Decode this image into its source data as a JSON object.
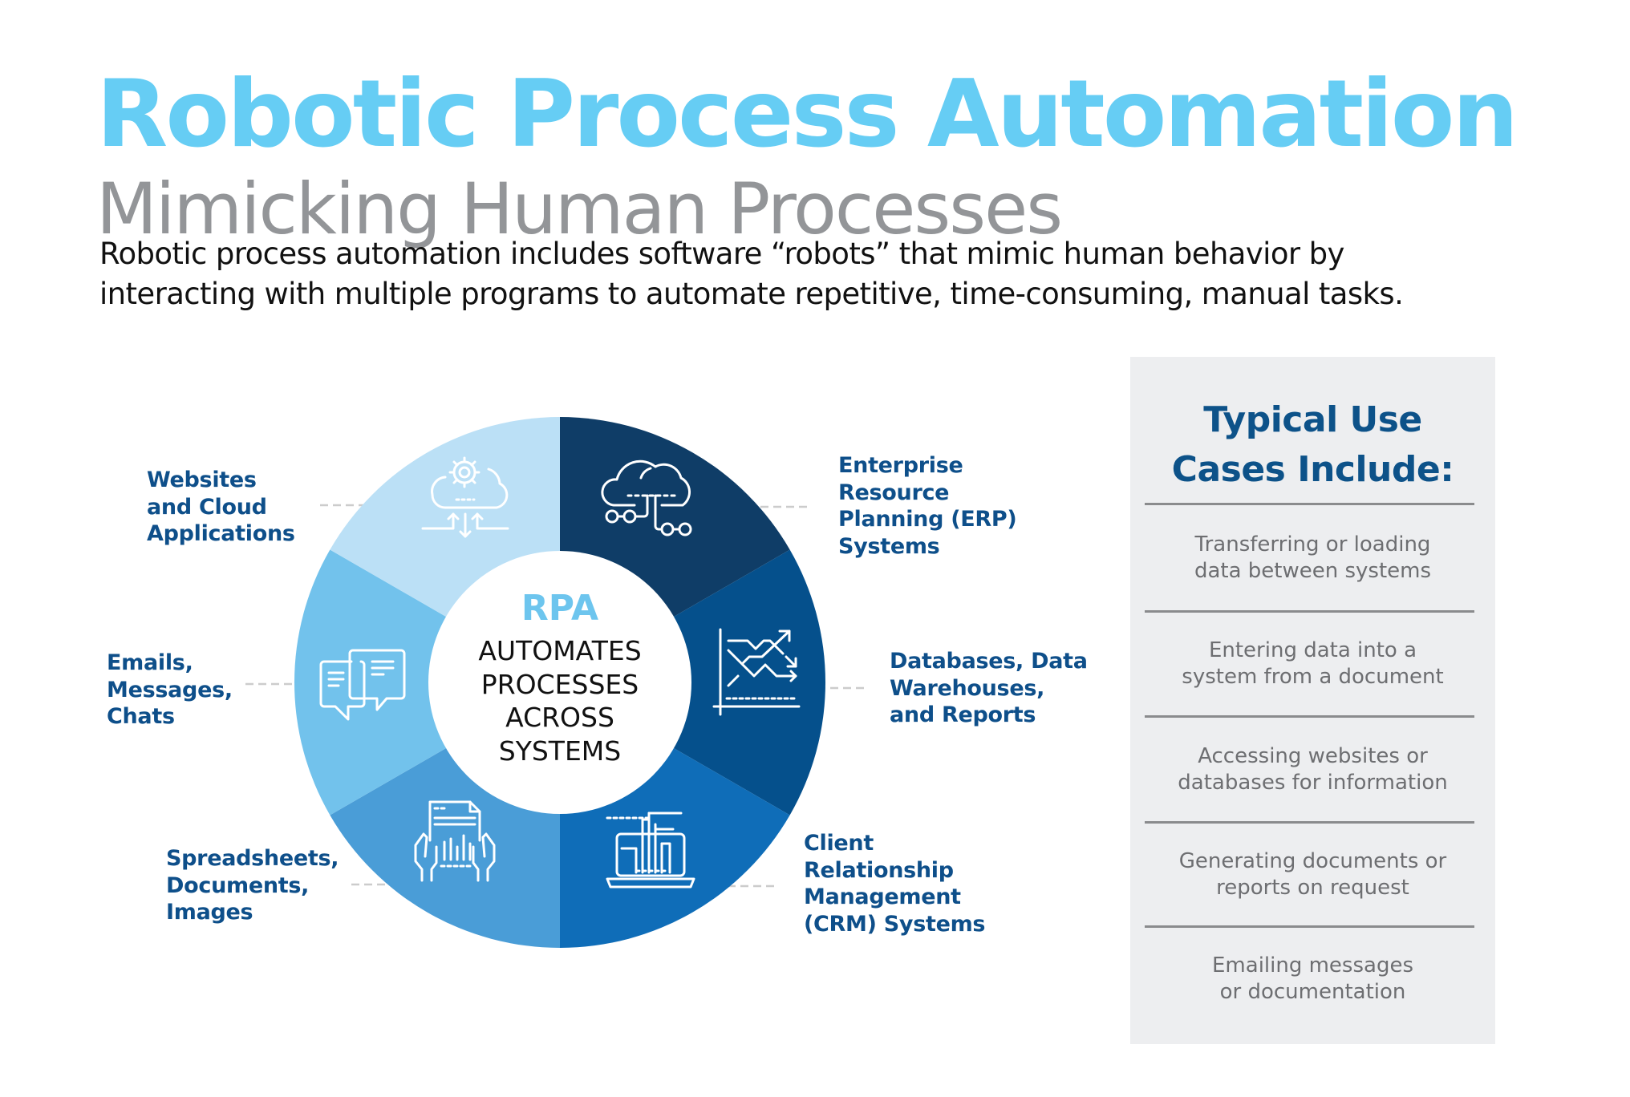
{
  "header": {
    "title": "Robotic Process Automation",
    "subtitle": "Mimicking Human Processes",
    "intro_lines": [
      "Robotic process automation includes software “robots” that mimic human behavior by",
      "interacting with multiple programs to automate repetitive, time-consuming, manual tasks."
    ]
  },
  "wheel": {
    "center": {
      "title": "RPA",
      "lines": [
        "AUTOMATES",
        "PROCESSES",
        "ACROSS",
        "SYSTEMS"
      ]
    },
    "segments": [
      {
        "id": "erp",
        "label_lines": [
          "Enterprise",
          "Resource",
          "Planning (ERP)",
          "Systems"
        ],
        "color": "#0F3D67",
        "icon": "cloud-network-icon"
      },
      {
        "id": "databases",
        "label_lines": [
          "Databases, Data",
          "Warehouses,",
          "and Reports"
        ],
        "color": "#05508C",
        "icon": "line-chart-icon"
      },
      {
        "id": "crm",
        "label_lines": [
          "Client",
          "Relationship",
          "Management",
          "(CRM) Systems"
        ],
        "color": "#0F6DB8",
        "icon": "laptop-data-icon"
      },
      {
        "id": "spreadsheets",
        "label_lines": [
          "Spreadsheets,",
          "Documents,",
          "Images"
        ],
        "color": "#4A9DD7",
        "icon": "document-hands-icon"
      },
      {
        "id": "emails",
        "label_lines": [
          "Emails,",
          "Messages,",
          "Chats"
        ],
        "color": "#72C2EC",
        "icon": "chat-bubbles-icon"
      },
      {
        "id": "websites",
        "label_lines": [
          "Websites",
          "and Cloud",
          "Applications"
        ],
        "color": "#BBE0F6",
        "icon": "cloud-gear-icon"
      }
    ]
  },
  "use_cases": {
    "title_lines": [
      "Typical Use",
      "Cases Include:"
    ],
    "items": [
      {
        "lines": [
          "Transferring or loading",
          "data between systems"
        ]
      },
      {
        "lines": [
          "Entering data into a",
          "system from a document"
        ]
      },
      {
        "lines": [
          "Accessing websites or",
          "databases for information"
        ]
      },
      {
        "lines": [
          "Generating documents or",
          "reports on request"
        ]
      },
      {
        "lines": [
          "Emailing messages",
          "or documentation"
        ]
      }
    ]
  },
  "colors": {
    "title": "#66CDF4",
    "subtitle": "#939598",
    "label": "#0E4F8A",
    "panel_bg": "#EDEEF0",
    "panel_title": "#0D5289",
    "use_case_text": "#6D6E71"
  }
}
